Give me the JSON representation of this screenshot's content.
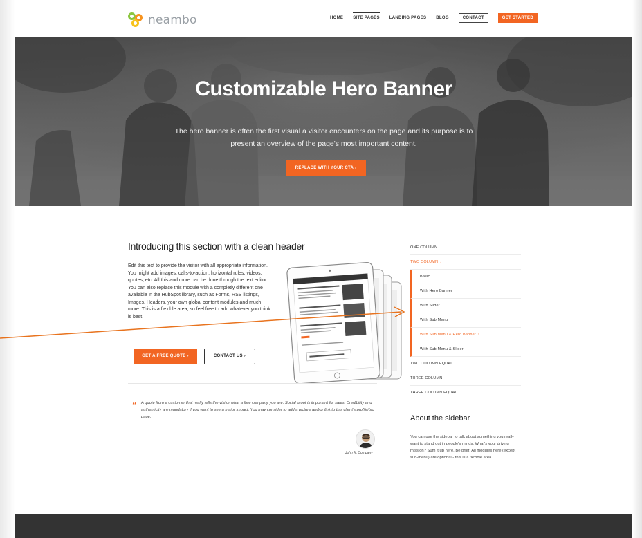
{
  "header": {
    "logo_text": "neambo",
    "nav": {
      "home": "HOME",
      "site_pages": "SITE PAGES",
      "landing_pages": "LANDING PAGES",
      "blog": "BLOG",
      "contact": "CONTACT",
      "get_started": "GET STARTED"
    }
  },
  "hero": {
    "title": "Customizable Hero Banner",
    "text": "The hero banner is often the first visual a visitor encounters on the page and its purpose is to present an overview of the page's most important content.",
    "cta": "REPLACE WITH YOUR CTA ›"
  },
  "main": {
    "header": "Introducing this section with a clean header",
    "body": "Edit this text to provide the visitor with all appropriate information. You might add images, calls-to-action, horizontal rules, videos, quotes, etc. All this and more can be done through the text editor. You can also replace this module with a completly different one available in the HubSpot library, such as Forms, RSS listings, Images, Headers, your own global content modules and much more. This is a flexible area, so feel free to add whatever you think is best.",
    "btn_quote": "GET A FREE QUOTE ›",
    "btn_contact": "CONTACT US ›",
    "quote": "A quote from a customer that really tells the visitor what a free company you are.  Social proof is important for sales. Credibility and authenticity are mandatory if you want to see a major impact. You may consider to add a picture and/or link to this client's profile/bio page.",
    "quote_author": "John X, Company"
  },
  "sidebar": {
    "menu": [
      {
        "label": "ONE COLUMN",
        "style": "normal"
      },
      {
        "label": "TWO COLUMN",
        "style": "orange",
        "chevron": "›"
      },
      {
        "label": "Basic",
        "style": "sub"
      },
      {
        "label": "With Hero Banner",
        "style": "sub"
      },
      {
        "label": "With Slider",
        "style": "sub"
      },
      {
        "label": "With Sub Menu",
        "style": "sub"
      },
      {
        "label": "With Sub Menu & Hero Banner",
        "style": "sub-orange",
        "chevron": "›"
      },
      {
        "label": "With Sub Menu & Slider",
        "style": "sub"
      },
      {
        "label": "TWO COLUMN EQUAL",
        "style": "normal"
      },
      {
        "label": "THREE COLUMN",
        "style": "normal"
      },
      {
        "label": "THREE COLUMN EQUAL",
        "style": "normal"
      }
    ],
    "title": "About the sidebar",
    "text": "You can use the sidebar to talk about something you really want to stand out in people's minds. What's your driving mission? Sum it up here. Be brief. All modules here (except sub-menu) are optional - this is a flexible area."
  },
  "tablet_screen": {
    "cta_label": "Visit Our Blog For More Articles ›"
  },
  "colors": {
    "accent": "#f26522",
    "footer": "#333333",
    "annotation_arrow": "#e8731e"
  },
  "icons": {
    "quote": "quote-icon",
    "logo": "neambo-logo-icon"
  }
}
